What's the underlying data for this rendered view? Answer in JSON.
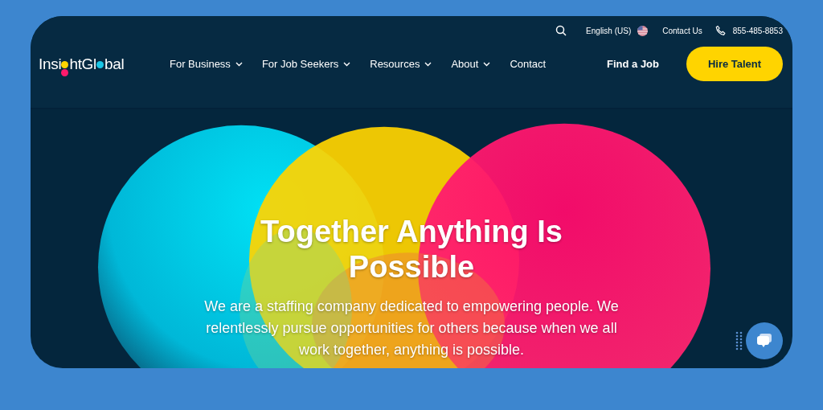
{
  "top_bar": {
    "language": "English (US)",
    "contact": "Contact Us",
    "phone": "855-485-8853"
  },
  "logo": {
    "segments": [
      "Insi",
      "htGl",
      "bal"
    ]
  },
  "nav": [
    {
      "label": "For Business",
      "dropdown": true
    },
    {
      "label": "For Job Seekers",
      "dropdown": true
    },
    {
      "label": "Resources",
      "dropdown": true
    },
    {
      "label": "About",
      "dropdown": true
    },
    {
      "label": "Contact",
      "dropdown": false
    }
  ],
  "actions": {
    "link": "Find a Job",
    "button": "Hire Talent"
  },
  "hero": {
    "title": "Together Anything Is Possible",
    "text": "We are a staffing company dedicated to empowering people. We relentlessly pursue opportunities for others because when we all work together, anything is possible."
  }
}
